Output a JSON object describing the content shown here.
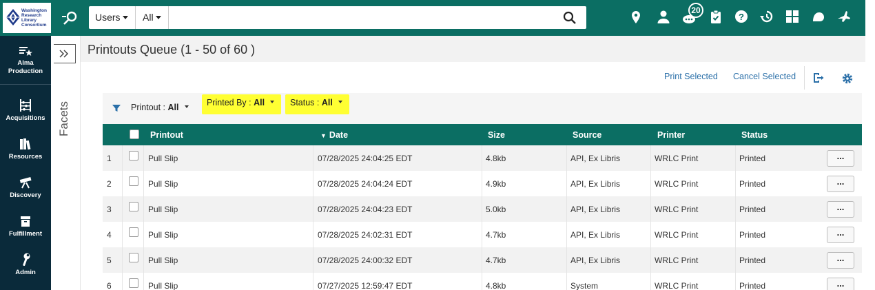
{
  "logo": {
    "lines": [
      "Washington",
      "Research",
      "Library",
      "Consortium"
    ]
  },
  "search": {
    "scope": "Users",
    "scope2": "All",
    "placeholder": "",
    "value": ""
  },
  "top_icons": [
    "location-icon",
    "user-icon",
    "tasks-icon",
    "clipboard-icon",
    "help-icon",
    "history-icon",
    "widgets-icon",
    "notifications-icon",
    "launch-icon"
  ],
  "tasks_badge": "20",
  "leftnav": {
    "items": [
      {
        "label": "Alma\nProduction",
        "icon": "alma-menu-icon"
      },
      {
        "label": "Acquisitions",
        "icon": "abacus-icon"
      },
      {
        "label": "Resources",
        "icon": "books-icon"
      },
      {
        "label": "Discovery",
        "icon": "telescope-icon"
      },
      {
        "label": "Fulfillment",
        "icon": "box-icon"
      },
      {
        "label": "Admin",
        "icon": "wrench-icon"
      }
    ]
  },
  "facets": {
    "label": "Facets"
  },
  "page": {
    "title": "Printouts Queue (1 - 50 of 60 )"
  },
  "actions": {
    "print_selected": "Print Selected",
    "cancel_selected": "Cancel Selected"
  },
  "filters": {
    "printout": {
      "label": "Printout :",
      "value": "All"
    },
    "printed_by": {
      "label": "Printed By :",
      "value": "All"
    },
    "status": {
      "label": "Status :",
      "value": "All"
    }
  },
  "table": {
    "columns": {
      "printout": "Printout",
      "date": "Date",
      "size": "Size",
      "source": "Source",
      "printer": "Printer",
      "status": "Status"
    },
    "sort_indicator": "▼",
    "rows": [
      {
        "num": "1",
        "printout": "Pull Slip",
        "date": "07/28/2025 24:04:25 EDT",
        "size": "4.8kb",
        "source": "API, Ex Libris",
        "printer": "WRLC Print",
        "status": "Printed"
      },
      {
        "num": "2",
        "printout": "Pull Slip",
        "date": "07/28/2025 24:04:24 EDT",
        "size": "4.9kb",
        "source": "API, Ex Libris",
        "printer": "WRLC Print",
        "status": "Printed"
      },
      {
        "num": "3",
        "printout": "Pull Slip",
        "date": "07/28/2025 24:04:23 EDT",
        "size": "5.0kb",
        "source": "API, Ex Libris",
        "printer": "WRLC Print",
        "status": "Printed"
      },
      {
        "num": "4",
        "printout": "Pull Slip",
        "date": "07/28/2025 24:02:31 EDT",
        "size": "4.7kb",
        "source": "API, Ex Libris",
        "printer": "WRLC Print",
        "status": "Printed"
      },
      {
        "num": "5",
        "printout": "Pull Slip",
        "date": "07/28/2025 24:00:32 EDT",
        "size": "4.7kb",
        "source": "API, Ex Libris",
        "printer": "WRLC Print",
        "status": "Printed"
      },
      {
        "num": "6",
        "printout": "Pull Slip",
        "date": "07/27/2025 12:59:47 EDT",
        "size": "4.8kb",
        "source": "System",
        "printer": "WRLC Print",
        "status": "Printed"
      }
    ],
    "more_label": "..."
  },
  "colors": {
    "header_teal": "#0b6e63",
    "nav_dark": "#0a2a3a",
    "link_blue": "#2a6fa8",
    "highlight": "#ffff33"
  }
}
